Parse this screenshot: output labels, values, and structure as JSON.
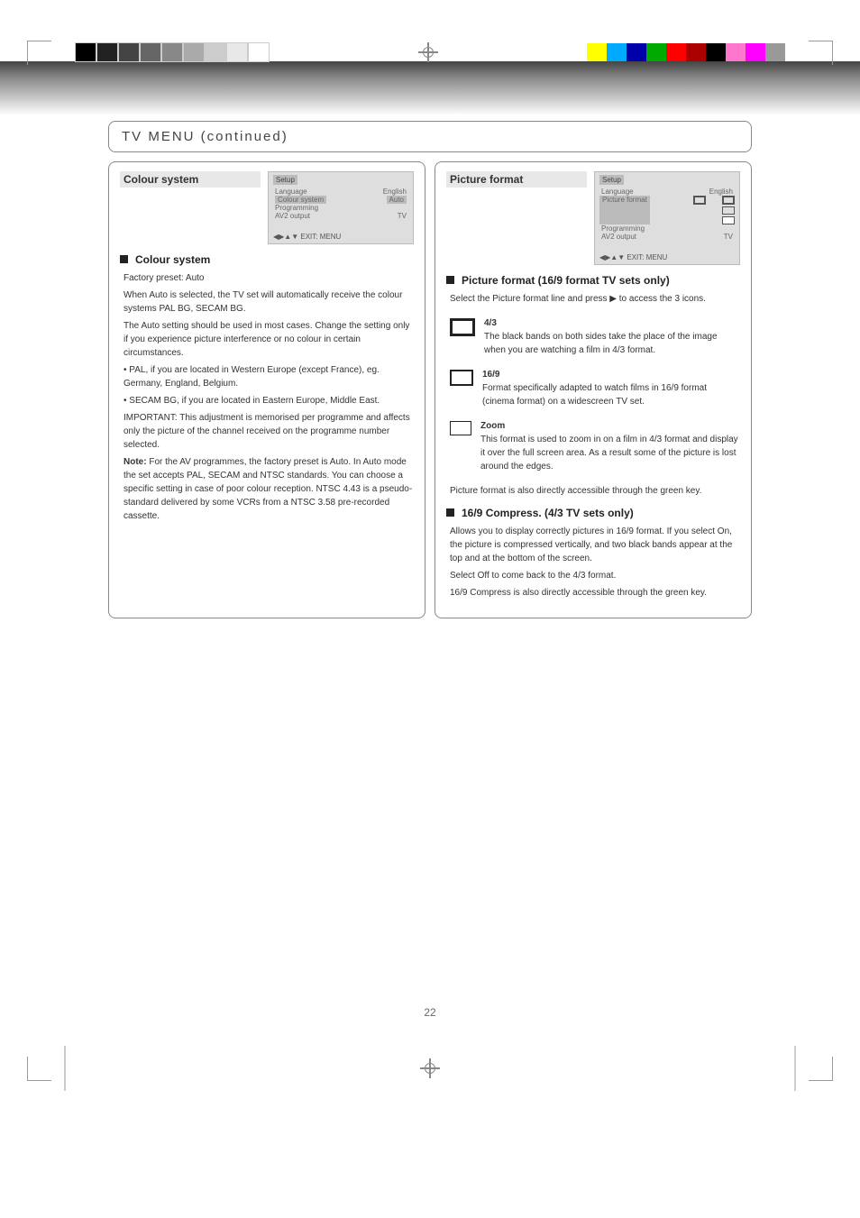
{
  "header": "TV MENU  (continued)",
  "page_number": "22",
  "left": {
    "title": "Colour system",
    "osd": {
      "heading": "Setup",
      "rows": [
        {
          "k": "Language",
          "v": "English"
        },
        {
          "k": "Colour system",
          "v": "Auto",
          "hl": true
        },
        {
          "k": "Programming",
          "v": ""
        },
        {
          "k": "AV2 output",
          "v": "TV"
        }
      ],
      "nav": "◀▶▲▼  EXIT: MENU"
    },
    "section_title": "Colour system",
    "paragraphs": [
      "Factory preset: Auto",
      "When Auto is selected, the TV set will automatically receive the colour systems PAL BG, SECAM BG.",
      "The Auto setting should be used in most cases. Change the setting only if you experience picture interference or no colour in certain circumstances.",
      "• PAL, if you are located in Western Europe (except France), eg. Germany, England, Belgium.",
      "• SECAM BG, if you are located in Eastern Europe, Middle East.",
      "IMPORTANT: This adjustment is memorised per programme and affects only the picture of the channel received on the programme number selected."
    ],
    "note_label": "Note:",
    "note_text": "For the AV programmes, the factory preset is Auto. In Auto mode the set accepts PAL, SECAM and NTSC standards. You can choose a specific setting in case of poor colour reception. NTSC 4.43 is a pseudo-standard delivered by some VCRs from a NTSC 3.58 pre-recorded cassette."
  },
  "right": {
    "title": "Picture format",
    "osd": {
      "heading": "Setup",
      "rows": [
        {
          "k": "Language",
          "v": "English"
        },
        {
          "k": "Picture format",
          "v": "",
          "hl": true
        },
        {
          "k": "Programming",
          "v": ""
        },
        {
          "k": "AV2 output",
          "v": "TV"
        }
      ],
      "nav": "◀▶▲▼  EXIT: MENU"
    },
    "section1_title": "Picture format  (16/9 format TV sets only)",
    "section1_intro": "Select the Picture format line and press ▶ to access the 3 icons.",
    "formats": [
      {
        "icon": "thick",
        "label": "4/3",
        "text": "The black bands on both sides take the place of the image when you are watching a film in 4/3 format."
      },
      {
        "icon": "thick",
        "label": "16/9",
        "text": "Format specifically adapted to watch films in 16/9 format (cinema format) on a widescreen TV set."
      },
      {
        "icon": "thin",
        "label": "Zoom",
        "text": "This format is used to zoom in on a film in 4/3 format and display it over the full screen area. As a result some of the picture is lost around the edges."
      }
    ],
    "direct_note": "Picture format is also directly accessible through the green key.",
    "section2_title": "16/9 Compress.  (4/3 TV sets only)",
    "paragraphs2": [
      "Allows you to display correctly pictures in 16/9 format. If you select On, the picture is compressed vertically, and two black bands appear at the top and at the bottom of the screen.",
      "Select Off to come back to the 4/3 format."
    ],
    "direct_note2": "16/9 Compress is also directly accessible through the green key."
  }
}
